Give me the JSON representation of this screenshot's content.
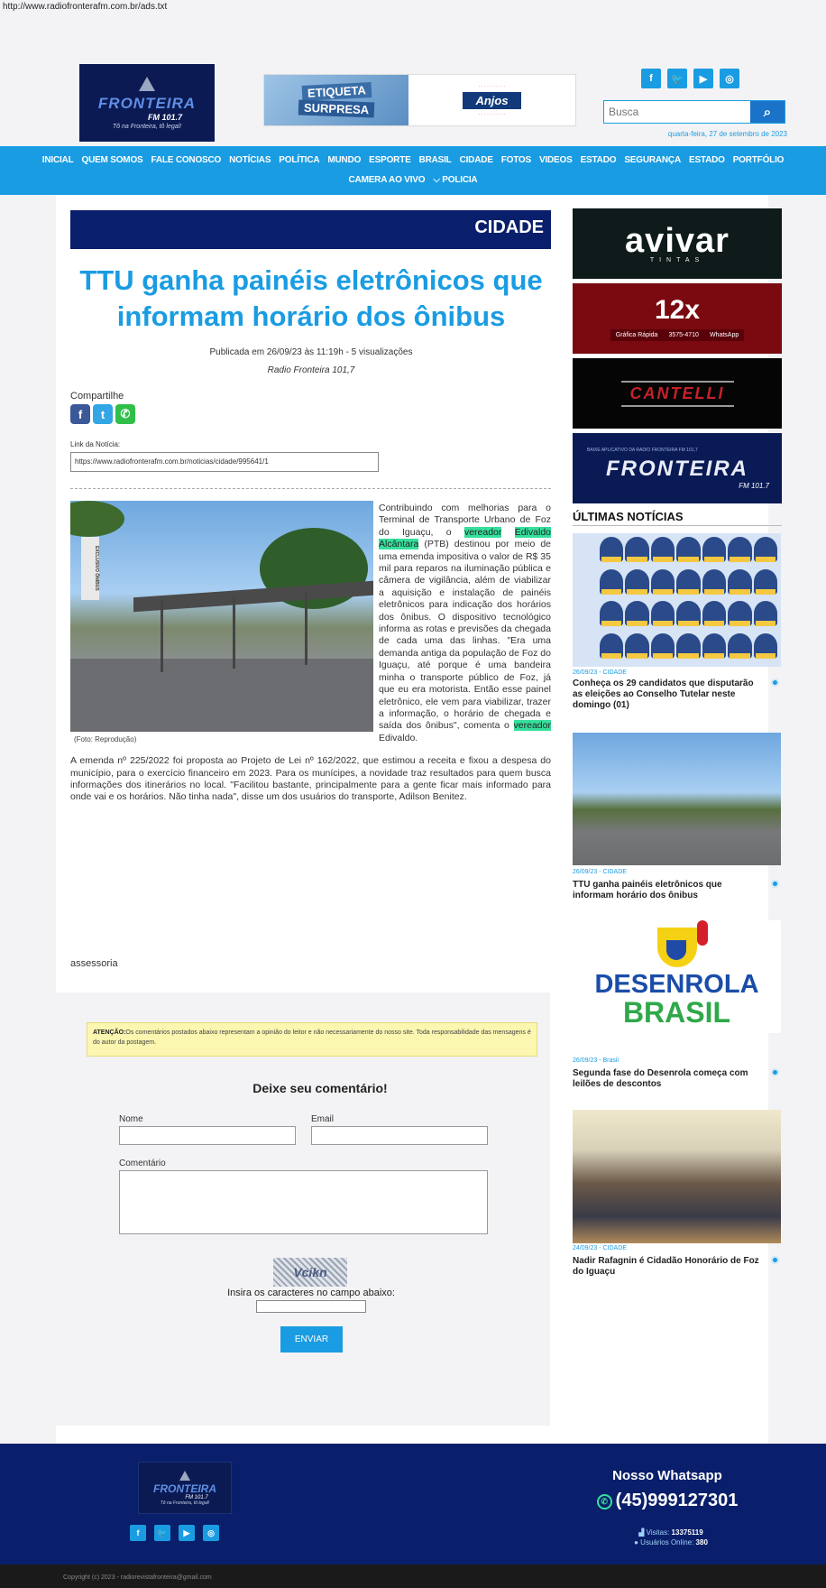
{
  "page": {
    "url_text": "http://www.radiofronterafm.com.br/ads.txt"
  },
  "header": {
    "logo": {
      "name": "FRONTEIRA",
      "fm": "FM 101.7",
      "slogan": "Tô na Fronteira, tô legal!"
    },
    "banner": {
      "left_line1": "ETIQUETA",
      "left_line2": "SURPRESA",
      "brand": "Anjos"
    },
    "social": [
      "f",
      "t",
      "yt",
      "ig"
    ],
    "search": {
      "placeholder": "Busca",
      "button_icon": "search-icon"
    },
    "date": "quarta-feira, 27 de setembro de 2023"
  },
  "nav": {
    "row1": [
      "INICIAL",
      "QUEM SOMOS",
      "FALE CONOSCO",
      "NOTÍCIAS",
      "POLÍTICA",
      "MUNDO",
      "ESPORTE",
      "BRASIL",
      "CIDADE",
      "FOTOS",
      "VIDEOS",
      "ESTADO",
      "SEGURANÇA",
      "ESTADO",
      "PORTFÓLIO"
    ],
    "row2": [
      "CAMERA AO VIVO",
      "⌵ POLICIA"
    ]
  },
  "article": {
    "category": "CIDADE",
    "title": "TTU ganha painéis eletrônicos que informam horário dos ônibus",
    "published": "Publicada em 26/09/23 às 11:19h - 5 visualizações",
    "source": "Radio Fronteira 101,7",
    "share_label": "Compartilhe",
    "link_label": "Link da Notícia:",
    "link_value": "https://www.radiofronterafm.com.br/noticias/cidade/995641/1",
    "photo_caption": "(Foto: Reprodução)",
    "p1_a": "Contribuindo com melhorias para o Terminal de Transporte Urbano de Foz do Iguaçu, o ",
    "p1_hl1": "vereador",
    "p1_b": " ",
    "p1_hl2": "Edivaldo Alcântara",
    "p1_c": " (PTB) destinou por meio de uma emenda impositiva o valor de R$ 35 mil para reparos na iluminação pública e câmera de vigilância, além de viabilizar a aquisição e instalação de painéis eletrônicos para indicação dos horários dos ônibus. O dispositivo tecnológico informa as rotas e previsões da chegada de cada uma das linhas. \"Era uma demanda antiga da população de Foz do Iguaçu, até porque é uma bandeira minha o transporte público de Foz, já que eu era motorista. Então esse painel eletrônico, ele vem para viabilizar, trazer a informação, o horário de chegada e saída dos ônibus\", comenta o ",
    "p1_hl3": "vereador",
    "p1_d": " Edivaldo.",
    "p2": "A emenda nº 225/2022 foi proposta ao Projeto de Lei nº 162/2022, que estimou a receita e fixou a despesa do município, para o exercício financeiro em 2023. Para os munícipes, a novidade traz resultados para quem busca informações dos itinerários no local. \"Facilitou bastante, principalmente para a gente ficar mais informado para onde vai e os horários. Não tinha nada\", disse um dos usuários do transporte, Adilson Benitez.",
    "footer_text": "assessoria"
  },
  "comments": {
    "notice_bold": "ATENÇÃO:",
    "notice_text": "Os comentários postados abaixo representam a opinião do leitor e não necessariamente do nosso site. Toda responsabilidade das mensagens é do autor da postagem.",
    "title": "Deixe seu comentário!",
    "name_label": "Nome",
    "email_label": "Email",
    "comment_label": "Comentário",
    "captcha_text": "Vcikn",
    "captcha_label": "Insira os caracteres no campo abaixo:",
    "submit": "ENVIAR"
  },
  "sidebar": {
    "ads": {
      "avivar": "avivar",
      "avivar_sub": "TINTAS",
      "ad2_big": "12x",
      "ad2_a": "Gráfica Rápida",
      "ad2_b": "3575-4710",
      "ad2_c": "WhatsApp",
      "ad3": "CANTELLI",
      "ad4_small": "BAIXE APLICATIVO DA RADIO FRONTEIRA FM 101,7",
      "ad4_big": "FRONTEIRA",
      "ad4_fm": "FM 101.7"
    },
    "latest_title": "ÚLTIMAS NOTÍCIAS",
    "news": [
      {
        "date": "26/09/23 - CIDADE",
        "title": "Conheça os 29 candidatos que disputarão as eleições ao Conselho Tutelar neste domingo (01)"
      },
      {
        "date": "26/09/23 - CIDADE",
        "title": "TTU ganha painéis eletrônicos que informam horário dos ônibus"
      },
      {
        "date": "26/09/23 - Brasil",
        "title": "Segunda fase do Desenrola começa com leilões de descontos",
        "logo_w1": "DESENROLA",
        "logo_w2": "BRASIL"
      },
      {
        "date": "24/09/23 - CIDADE",
        "title": "Nadir Rafagnin é Cidadão Honorário de Foz do Iguaçu"
      }
    ]
  },
  "footer": {
    "whatsapp_title": "Nosso Whatsapp",
    "whatsapp_number": "(45)999127301",
    "visits_label": "Visitas:",
    "visits_value": "13375119",
    "online_label": "Usuários Online:",
    "online_value": "380",
    "copyright": "Copyright (c) 2023 - radiorevistafronteira@gmail.com"
  },
  "colors": {
    "accent": "#1a9ce2",
    "navy": "#0a1f6b",
    "highlight": "#35e09c"
  }
}
